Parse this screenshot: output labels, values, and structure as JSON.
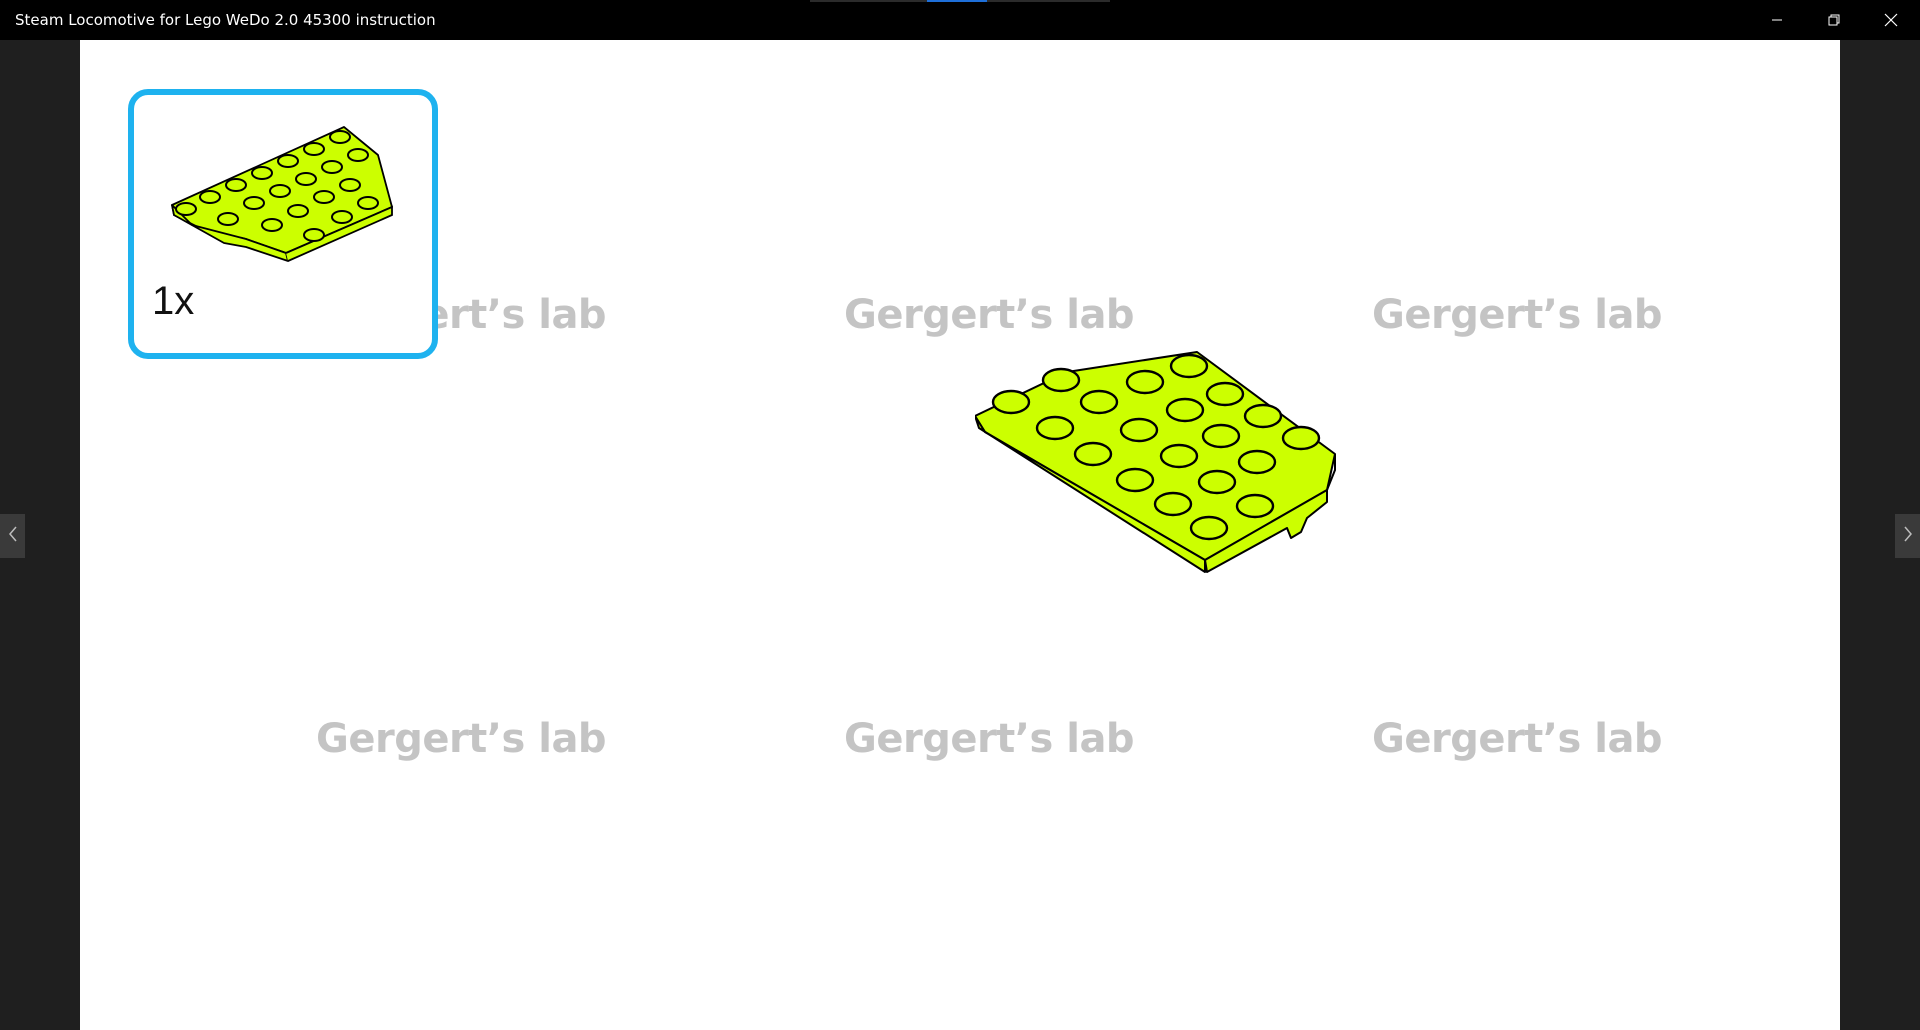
{
  "window": {
    "title": "Steam Locomotive for Lego WeDo 2.0 45300 instruction",
    "controls": {
      "minimize_icon": "minimize-icon",
      "restore_icon": "restore-icon",
      "close_icon": "close-icon"
    }
  },
  "viewer": {
    "prev_icon": "chevron-left-icon",
    "next_icon": "chevron-right-icon"
  },
  "page": {
    "watermark_text": "Gergert’s lab",
    "parts_list": {
      "items": [
        {
          "quantity": "1x",
          "part_color": "#ccff00"
        }
      ],
      "border_color": "#1eb2ef"
    },
    "build_step": {
      "part_color": "#ccff00"
    }
  },
  "colors": {
    "titlebar_bg": "#000000",
    "viewer_bg": "#1f1f1f",
    "page_bg": "#ffffff",
    "watermark": "#c4c4c4",
    "accent": "#1eb2ef",
    "part_lime": "#ccff00"
  }
}
